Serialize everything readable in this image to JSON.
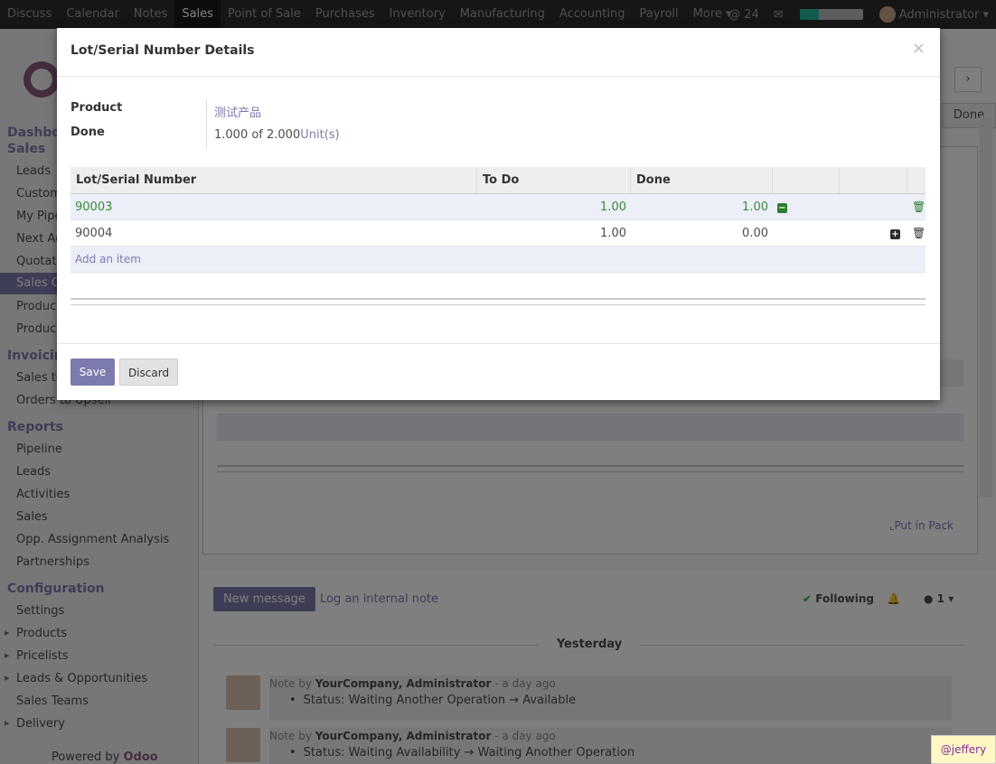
{
  "topnav": {
    "items": [
      "Discuss",
      "Calendar",
      "Notes",
      "Sales",
      "Point of Sale",
      "Purchases",
      "Inventory",
      "Manufacturing",
      "Accounting",
      "Payroll",
      "More"
    ],
    "active_index": 3,
    "notifications": "24",
    "progress": 0.3,
    "user": "Administrator"
  },
  "sidebar": {
    "section_dashboard": "Dashboa",
    "section_sales": "Sales",
    "sales_items": [
      "Leads",
      "Custom",
      "My Pipe",
      "Next Ac",
      "Quotatio",
      "Sales O",
      "Product",
      "Product"
    ],
    "section_invoicing": "Invoicing",
    "invoicing_items": [
      "Sales to",
      "Orders to Upsell"
    ],
    "section_reports": "Reports",
    "reports_items": [
      "Pipeline",
      "Leads",
      "Activities",
      "Sales",
      "Opp. Assignment Analysis",
      "Partnerships"
    ],
    "section_config": "Configuration",
    "config_items": [
      "Settings",
      "Products",
      "Pricelists",
      "Leads & Opportunities",
      "Sales Teams",
      "Delivery"
    ],
    "powered_by": "Powered by",
    "powered_brand": "Odoo"
  },
  "background": {
    "put_in_pack": "Put in Pack",
    "done_btn": "Done"
  },
  "chatter": {
    "new_message": "New message",
    "log_note": "Log an internal note",
    "following": "Following",
    "followers": "1",
    "day_separator": "Yesterday",
    "messages": [
      {
        "prefix": "Note by",
        "author": "YourCompany, Administrator",
        "time": "- a day ago",
        "change": "Status: Waiting Another Operation → Available"
      },
      {
        "prefix": "Note by",
        "author": "YourCompany, Administrator",
        "time": "- a day ago",
        "change": "Status: Waiting Availability → Waiting Another Operation"
      }
    ]
  },
  "modal": {
    "title": "Lot/Serial Number Details",
    "close": "×",
    "product_label": "Product",
    "product_value": "测试产品",
    "done_label": "Done",
    "done_value": "1.000 of 2.000",
    "done_uom": "Unit(s)",
    "columns": [
      "Lot/Serial Number",
      "To Do",
      "Done"
    ],
    "rows": [
      {
        "lot": "90003",
        "todo": "1.00",
        "done": "1.00"
      },
      {
        "lot": "90004",
        "todo": "1.00",
        "done": "0.00"
      }
    ],
    "add_item": "Add an item",
    "save": "Save",
    "discard": "Discard"
  },
  "watermark": "@jeffery"
}
